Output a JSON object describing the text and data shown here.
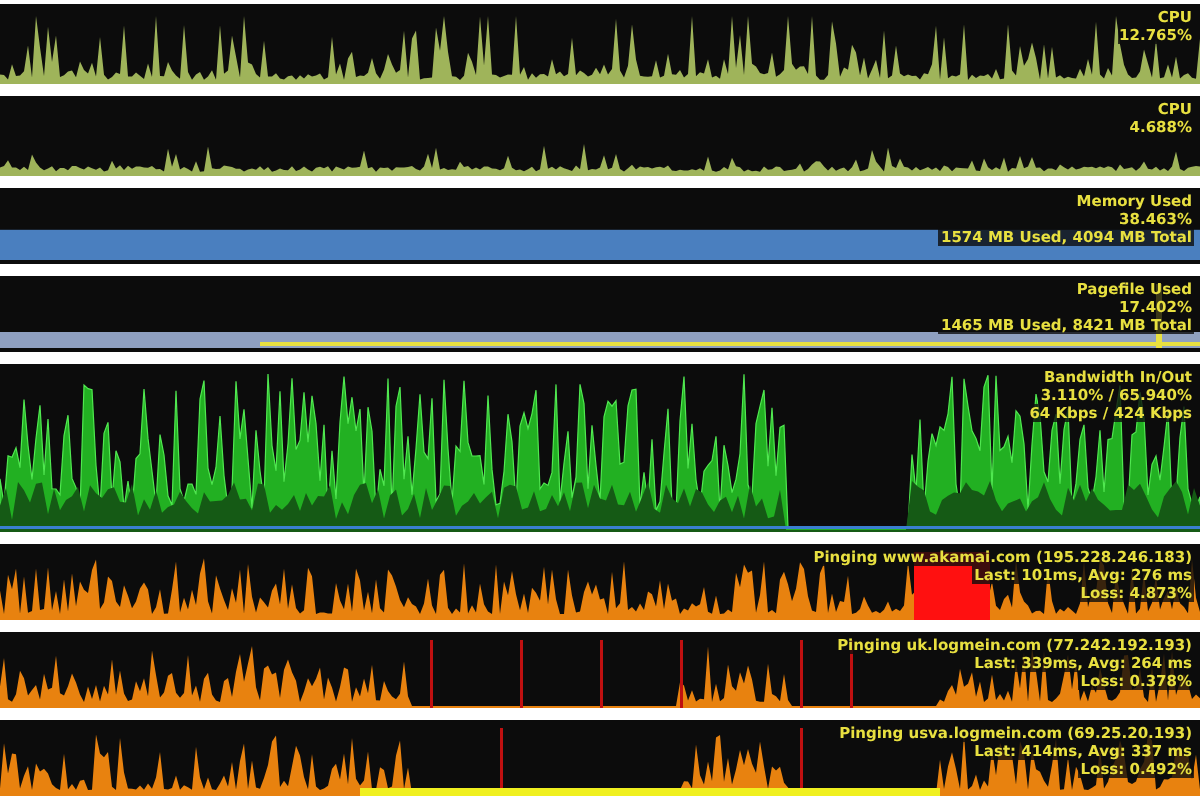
{
  "panels": [
    {
      "kind": "cpu",
      "lines": [
        "CPU",
        "12.765%"
      ]
    },
    {
      "kind": "cpu",
      "lines": [
        "CPU",
        "4.688%"
      ]
    },
    {
      "kind": "memory",
      "lines": [
        "Memory Used",
        "38.463%",
        "1574 MB Used, 4094 MB Total"
      ]
    },
    {
      "kind": "pagefile",
      "lines": [
        "Pagefile Used",
        "17.402%",
        "1465 MB Used, 8421 MB Total"
      ]
    },
    {
      "kind": "bandwidth",
      "lines": [
        "Bandwidth In/Out",
        "3.110% / 65.940%",
        "64 Kbps / 424 Kbps"
      ]
    },
    {
      "kind": "ping",
      "lines": [
        "Pinging www.akamai.com (195.228.246.183)",
        "Last: 101ms, Avg: 276 ms",
        "Loss: 4.873%"
      ]
    },
    {
      "kind": "ping",
      "lines": [
        "Pinging uk.logmein.com (77.242.192.193)",
        "Last: 339ms, Avg: 264 ms",
        "Loss: 0.378%"
      ]
    },
    {
      "kind": "ping",
      "lines": [
        "Pinging usva.logmein.com (69.25.20.193)",
        "Last: 414ms, Avg: 337 ms",
        "Loss: 0.492%"
      ]
    }
  ]
}
